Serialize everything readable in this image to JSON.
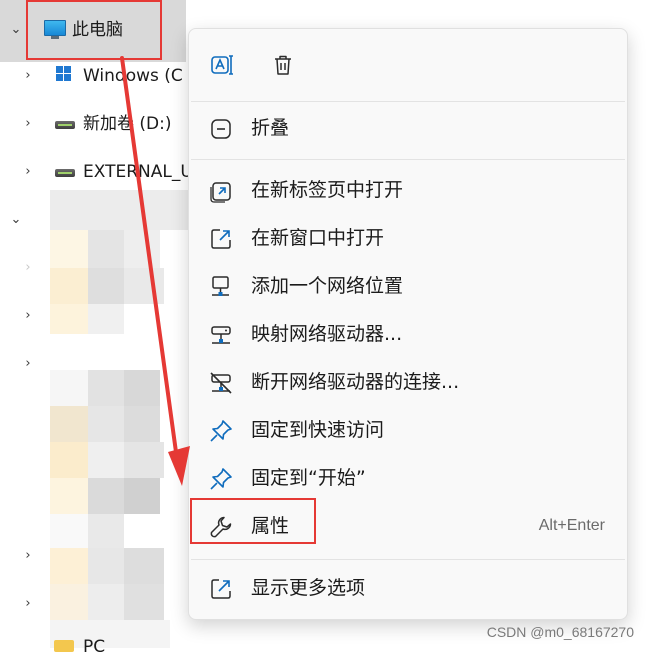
{
  "tree": {
    "this_pc_label": "此电脑",
    "drives": [
      {
        "label": "Windows (C"
      },
      {
        "label": "新加卷 (D:)"
      },
      {
        "label": "EXTERNAL_U"
      }
    ],
    "partial_label": "PC"
  },
  "menu": {
    "top_actions": [
      {
        "name": "rename-icon"
      },
      {
        "name": "trash-icon"
      }
    ],
    "items": [
      {
        "label": "折叠",
        "icon": "collapse-icon"
      },
      {
        "label": "在新标签页中打开",
        "icon": "open-new-tab-icon"
      },
      {
        "label": "在新窗口中打开",
        "icon": "open-new-window-icon"
      },
      {
        "label": "添加一个网络位置",
        "icon": "network-location-icon"
      },
      {
        "label": "映射网络驱动器...",
        "icon": "map-network-drive-icon"
      },
      {
        "label": "断开网络驱动器的连接...",
        "icon": "disconnect-network-drive-icon"
      },
      {
        "label": "固定到快速访问",
        "icon": "pin-icon"
      },
      {
        "label": "固定到“开始”",
        "icon": "pin-icon"
      },
      {
        "label": "属性",
        "icon": "wrench-icon",
        "shortcut": "Alt+Enter"
      },
      {
        "label": "显示更多选项",
        "icon": "show-more-icon"
      }
    ]
  },
  "watermark": "CSDN @m0_68167270",
  "colors": {
    "accent": "#0f6cbd",
    "annotation_red": "#e53935",
    "menu_bg": "#f9f9f9"
  }
}
